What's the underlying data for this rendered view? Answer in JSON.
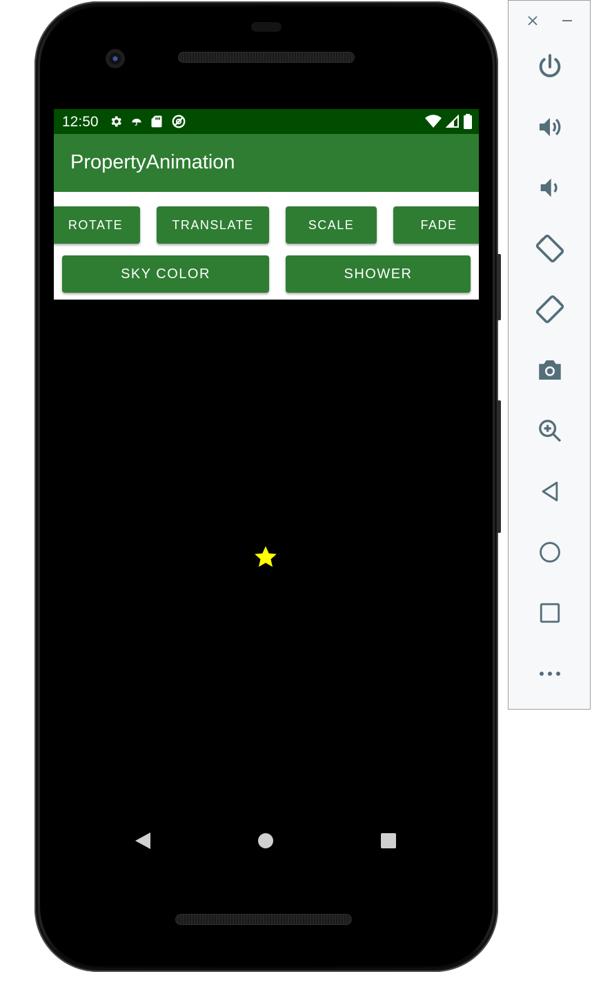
{
  "status_bar": {
    "time": "12:50"
  },
  "app_bar": {
    "title": "PropertyAnimation"
  },
  "buttons": {
    "rotate": "ROTATE",
    "translate": "TRANSLATE",
    "scale": "SCALE",
    "fade": "FADE",
    "sky_color": "SKY COLOR",
    "shower": "SHOWER"
  },
  "colors": {
    "status_bar": "#004d00",
    "primary": "#2e7d32",
    "star": "#ffff00",
    "sky": "#000000",
    "toolbar_icon": "#546e7a"
  },
  "status_icons": [
    "settings-icon",
    "umbrella-icon",
    "sd-card-icon",
    "data-saver-icon",
    "wifi-icon",
    "signal-icon",
    "battery-icon"
  ],
  "nav_bar": [
    "back-icon",
    "home-icon",
    "recents-icon"
  ],
  "emulator_toolbar": [
    "close",
    "minimize",
    "power",
    "volume-up",
    "volume-down",
    "rotate-left",
    "rotate-right",
    "screenshot",
    "zoom",
    "back",
    "home",
    "overview",
    "more"
  ]
}
